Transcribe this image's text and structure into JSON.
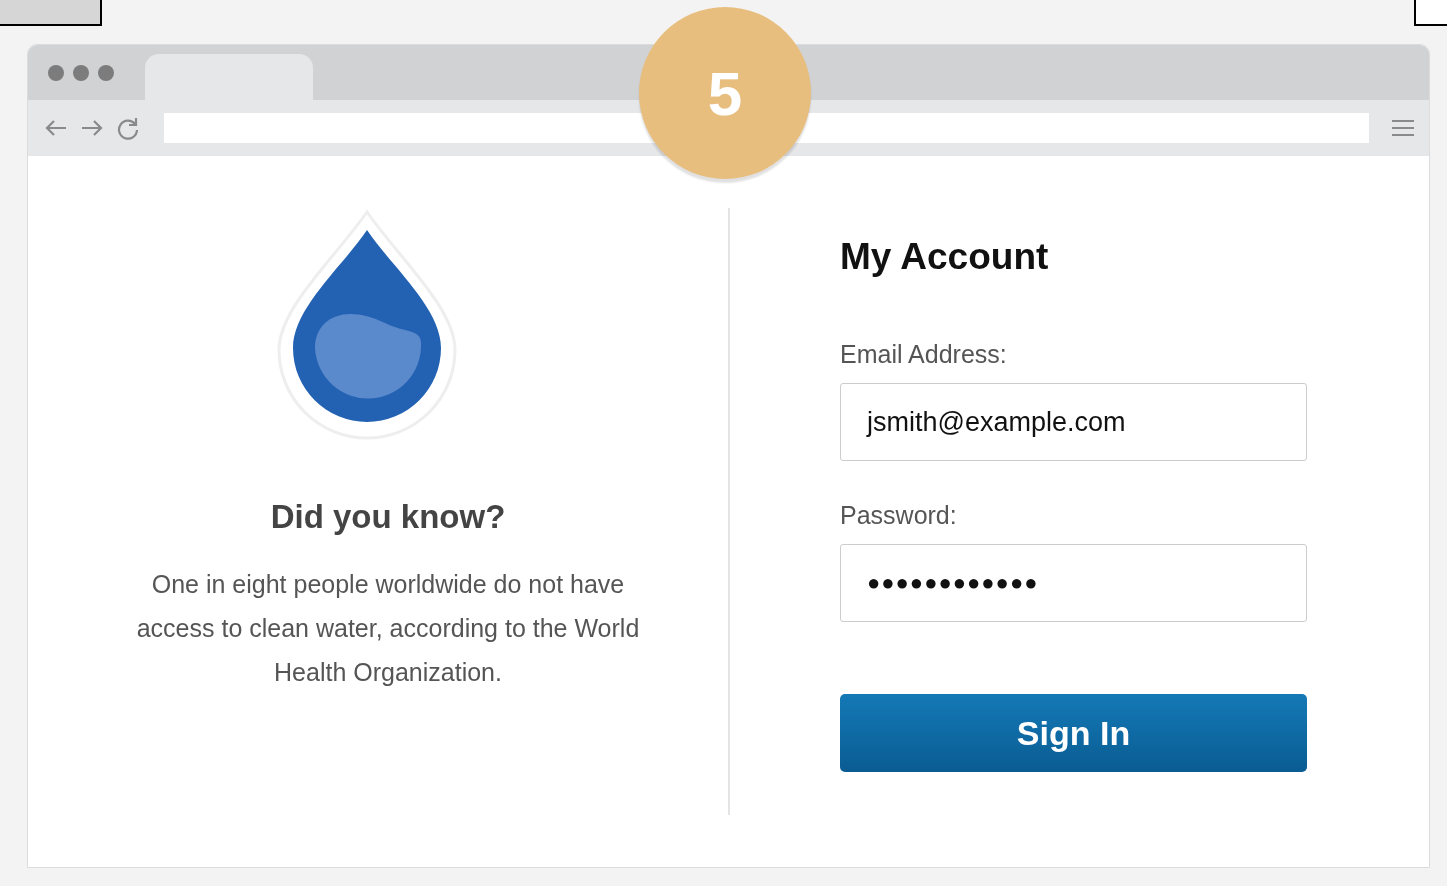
{
  "step_badge": "5",
  "info_panel": {
    "heading": "Did you know?",
    "text": "One in eight people worldwide do not have access to clean water, according to the World Health Organization."
  },
  "login_form": {
    "title": "My Account",
    "fields": [
      {
        "label": "Email Address:",
        "value": "jsmith@example.com",
        "kind": "text"
      },
      {
        "label": "Password:",
        "value": "●●●●●●●●●●●●",
        "kind": "password"
      }
    ],
    "button": "Sign In"
  }
}
